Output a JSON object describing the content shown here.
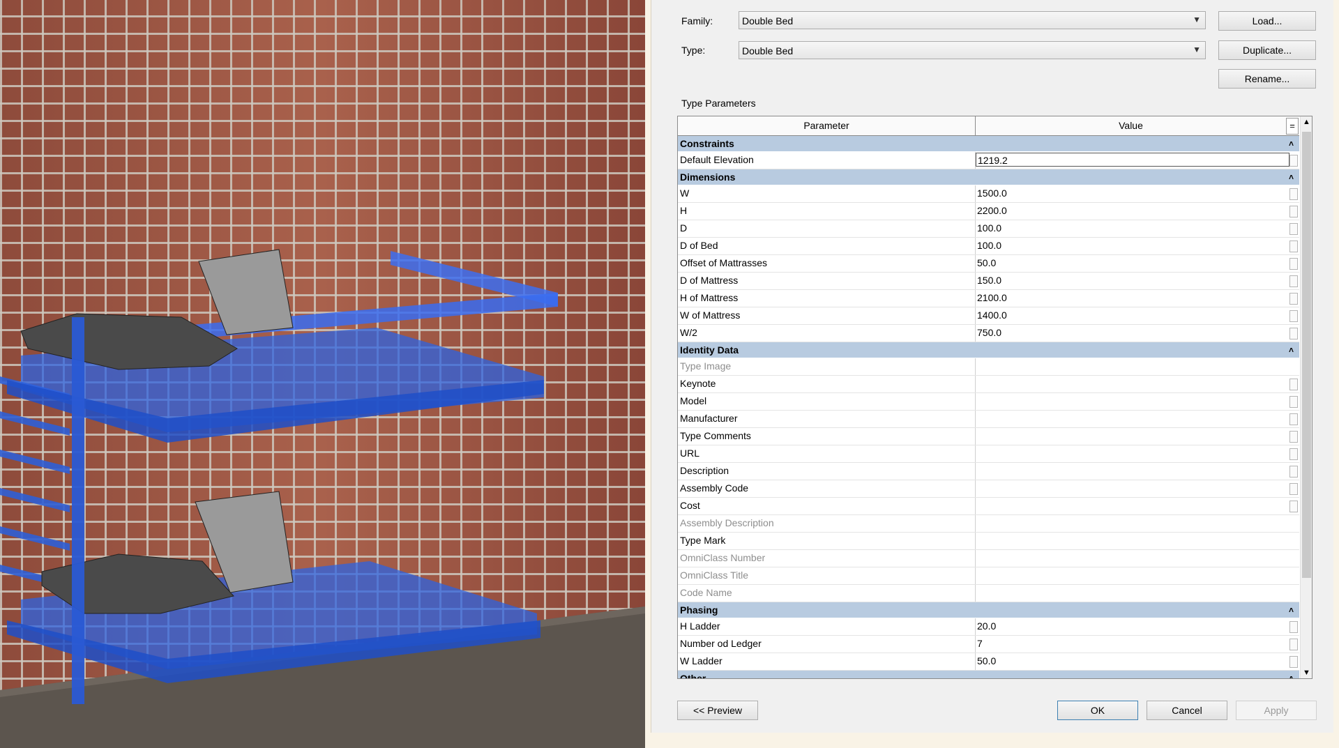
{
  "dialog": {
    "family_label": "Family:",
    "family_value": "Double Bed",
    "type_label": "Type:",
    "type_value": "Double Bed",
    "load_button": "Load...",
    "duplicate_button": "Duplicate...",
    "rename_button": "Rename...",
    "section_title": "Type Parameters",
    "col_parameter": "Parameter",
    "col_value": "Value",
    "eq_button": "=",
    "preview_button": "<< Preview",
    "ok_button": "OK",
    "cancel_button": "Cancel",
    "apply_button": "Apply"
  },
  "groups": [
    {
      "name": "Constraints",
      "rows": [
        {
          "param": "Default Elevation",
          "value": "1219.2",
          "editing": true,
          "btn": true
        }
      ]
    },
    {
      "name": "Dimensions",
      "rows": [
        {
          "param": "W",
          "value": "1500.0",
          "btn": true
        },
        {
          "param": "H",
          "value": "2200.0",
          "btn": true
        },
        {
          "param": "D",
          "value": "100.0",
          "btn": true
        },
        {
          "param": "D of Bed",
          "value": "100.0",
          "btn": true
        },
        {
          "param": "Offset of Mattrasses",
          "value": "50.0",
          "btn": true
        },
        {
          "param": "D of Mattress",
          "value": "150.0",
          "btn": true
        },
        {
          "param": "H of Mattress",
          "value": "2100.0",
          "btn": true
        },
        {
          "param": "W of Mattress",
          "value": "1400.0",
          "btn": true
        },
        {
          "param": "W/2",
          "value": "750.0",
          "btn": true
        }
      ]
    },
    {
      "name": "Identity Data",
      "rows": [
        {
          "param": "Type Image",
          "value": "",
          "dim": true
        },
        {
          "param": "Keynote",
          "value": "",
          "btn": true
        },
        {
          "param": "Model",
          "value": "",
          "btn": true
        },
        {
          "param": "Manufacturer",
          "value": "",
          "btn": true
        },
        {
          "param": "Type Comments",
          "value": "",
          "btn": true
        },
        {
          "param": "URL",
          "value": "",
          "btn": true
        },
        {
          "param": "Description",
          "value": "",
          "btn": true
        },
        {
          "param": "Assembly Code",
          "value": "",
          "btn": true
        },
        {
          "param": "Cost",
          "value": "",
          "btn": true
        },
        {
          "param": "Assembly Description",
          "value": "",
          "dim": true
        },
        {
          "param": "Type Mark",
          "value": ""
        },
        {
          "param": "OmniClass Number",
          "value": "",
          "dim": true
        },
        {
          "param": "OmniClass Title",
          "value": "",
          "dim": true
        },
        {
          "param": "Code Name",
          "value": "",
          "dim": true
        }
      ]
    },
    {
      "name": "Phasing",
      "rows": [
        {
          "param": "H Ladder",
          "value": "20.0",
          "btn": true
        },
        {
          "param": "Number od Ledger",
          "value": "7",
          "btn": true
        },
        {
          "param": "W Ladder",
          "value": "50.0",
          "btn": true
        }
      ]
    },
    {
      "name": "Other",
      "rows": []
    }
  ]
}
